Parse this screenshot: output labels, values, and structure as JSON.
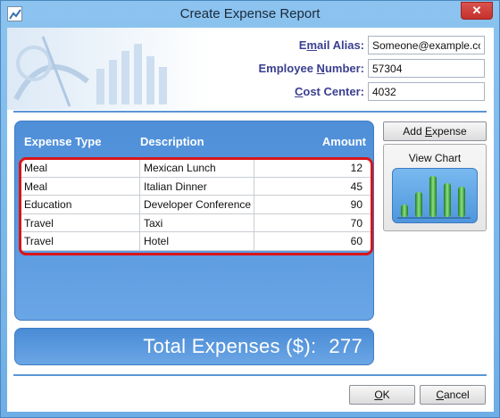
{
  "window": {
    "title": "Create Expense Report",
    "close_glyph": "✕"
  },
  "header": {
    "email": {
      "label_pre": "E",
      "label_ul": "m",
      "label_post": "ail Alias:",
      "value": "Someone@example.com"
    },
    "employee": {
      "label_pre": "Employee ",
      "label_ul": "N",
      "label_post": "umber:",
      "value": "57304"
    },
    "cost": {
      "label_pre": "",
      "label_ul": "C",
      "label_post": "ost Center:",
      "value": "4032"
    }
  },
  "table": {
    "columns": [
      "Expense Type",
      "Description",
      "Amount"
    ],
    "rows": [
      {
        "type": "Meal",
        "description": "Mexican Lunch",
        "amount": "12"
      },
      {
        "type": "Meal",
        "description": "Italian Dinner",
        "amount": "45"
      },
      {
        "type": "Education",
        "description": "Developer Conference",
        "amount": "90"
      },
      {
        "type": "Travel",
        "description": "Taxi",
        "amount": "70"
      },
      {
        "type": "Travel",
        "description": "Hotel",
        "amount": "60"
      }
    ]
  },
  "total": {
    "label": "Total Expenses ($):",
    "value": "277"
  },
  "buttons": {
    "add_expense_pre": "Add ",
    "add_expense_ul": "E",
    "add_expense_post": "xpense",
    "view_chart": "View Chart",
    "ok_ul": "O",
    "ok_post": "K",
    "cancel_ul": "C",
    "cancel_post": "ancel"
  },
  "colors": {
    "accent": "#5b96d6",
    "highlight": "#d8151b",
    "label": "#3b3f8f"
  }
}
